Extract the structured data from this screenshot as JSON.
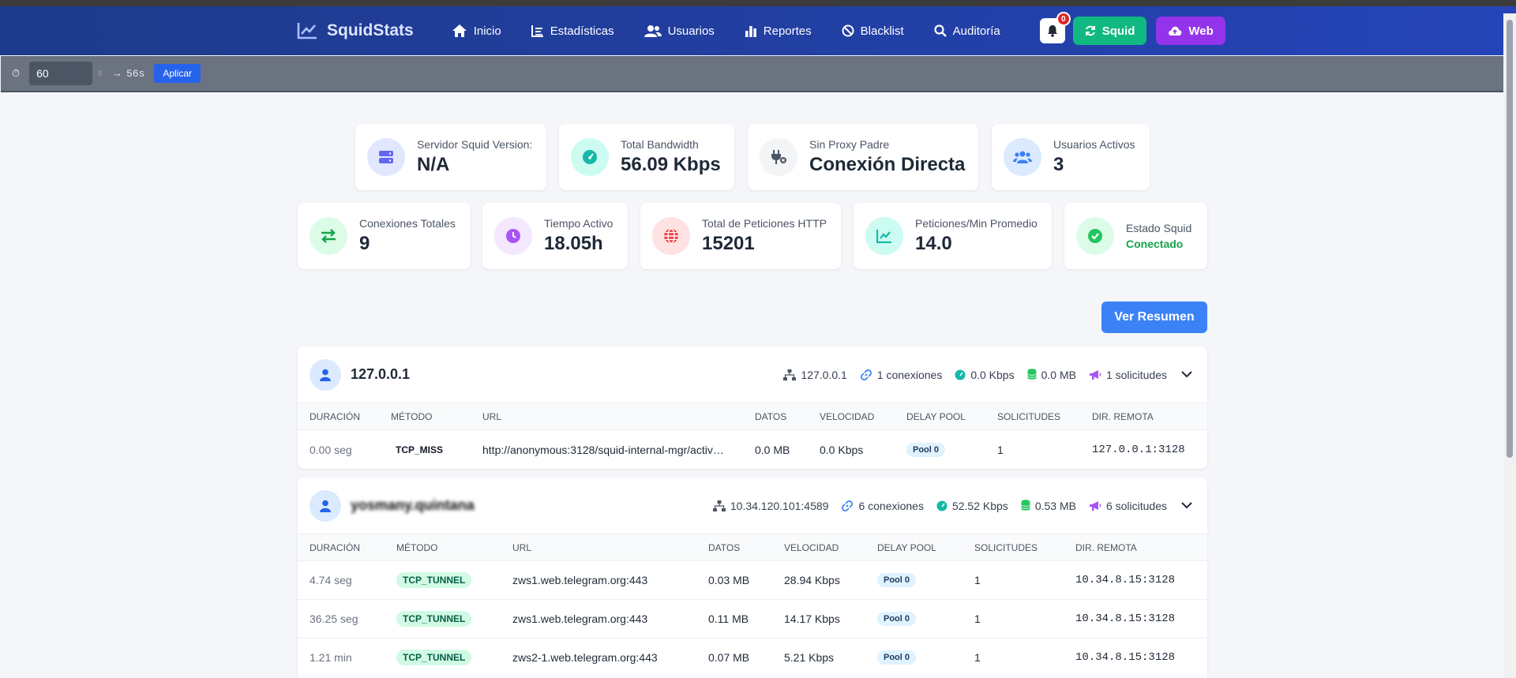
{
  "navbar": {
    "brand": "SquidStats",
    "items": [
      {
        "label": "Inicio",
        "icon": "home-icon"
      },
      {
        "label": "Estadísticas",
        "icon": "chart-list-icon"
      },
      {
        "label": "Usuarios",
        "icon": "users-icon"
      },
      {
        "label": "Reportes",
        "icon": "bar-chart-icon"
      },
      {
        "label": "Blacklist",
        "icon": "ban-icon"
      },
      {
        "label": "Auditoría",
        "icon": "search-icon"
      }
    ],
    "notifications_count": "0",
    "squid_button": "Squid",
    "web_button": "Web"
  },
  "refresh": {
    "interval": "60",
    "unit": "s",
    "countdown": "→ 56s",
    "apply": "Aplicar"
  },
  "stats_row1": [
    {
      "label": "Servidor Squid Version:",
      "value": "N/A"
    },
    {
      "label": "Total Bandwidth",
      "value": "56.09 Kbps"
    },
    {
      "label": "Sin Proxy Padre",
      "value": "Conexión Directa"
    },
    {
      "label": "Usuarios Activos",
      "value": "3"
    }
  ],
  "stats_row2": [
    {
      "label": "Conexiones Totales",
      "value": "9"
    },
    {
      "label": "Tiempo Activo",
      "value": "18.05h"
    },
    {
      "label": "Total de Peticiones HTTP",
      "value": "15201"
    },
    {
      "label": "Peticiones/Min Promedio",
      "value": "14.0"
    },
    {
      "label": "Estado Squid",
      "value": "Conectado"
    }
  ],
  "ver_resumen": "Ver Resumen",
  "columns": [
    "DURACIÓN",
    "MÉTODO",
    "URL",
    "DATOS",
    "VELOCIDAD",
    "DELAY POOL",
    "SOLICITUDES",
    "DIR. REMOTA"
  ],
  "users": [
    {
      "name": "127.0.0.1",
      "ip": "127.0.0.1",
      "connections": "1 conexiones",
      "speed": "0.0 Kbps",
      "data": "0.0 MB",
      "requests": "1 solicitudes",
      "rows": [
        {
          "duration": "0.00 seg",
          "method": "TCP_MISS",
          "url": "http://anonymous:3128/squid-internal-mgr/activ…",
          "data": "0.0 MB",
          "speed": "0.0 Kbps",
          "pool": "Pool 0",
          "requests": "1",
          "remote": "127.0.0.1:3128"
        }
      ]
    },
    {
      "name": "yosmany.quintana",
      "ip": "10.34.120.101:4589",
      "connections": "6 conexiones",
      "speed": "52.52 Kbps",
      "data": "0.53 MB",
      "requests": "6 solicitudes",
      "rows": [
        {
          "duration": "4.74 seg",
          "method": "TCP_TUNNEL",
          "url": "zws1.web.telegram.org:443",
          "data": "0.03 MB",
          "speed": "28.94 Kbps",
          "pool": "Pool 0",
          "requests": "1",
          "remote": "10.34.8.15:3128"
        },
        {
          "duration": "36.25 seg",
          "method": "TCP_TUNNEL",
          "url": "zws1.web.telegram.org:443",
          "data": "0.11 MB",
          "speed": "14.17 Kbps",
          "pool": "Pool 0",
          "requests": "1",
          "remote": "10.34.8.15:3128"
        },
        {
          "duration": "1.21 min",
          "method": "TCP_TUNNEL",
          "url": "zws2-1.web.telegram.org:443",
          "data": "0.07 MB",
          "speed": "5.21 Kbps",
          "pool": "Pool 0",
          "requests": "1",
          "remote": "10.34.8.15:3128"
        }
      ]
    }
  ]
}
